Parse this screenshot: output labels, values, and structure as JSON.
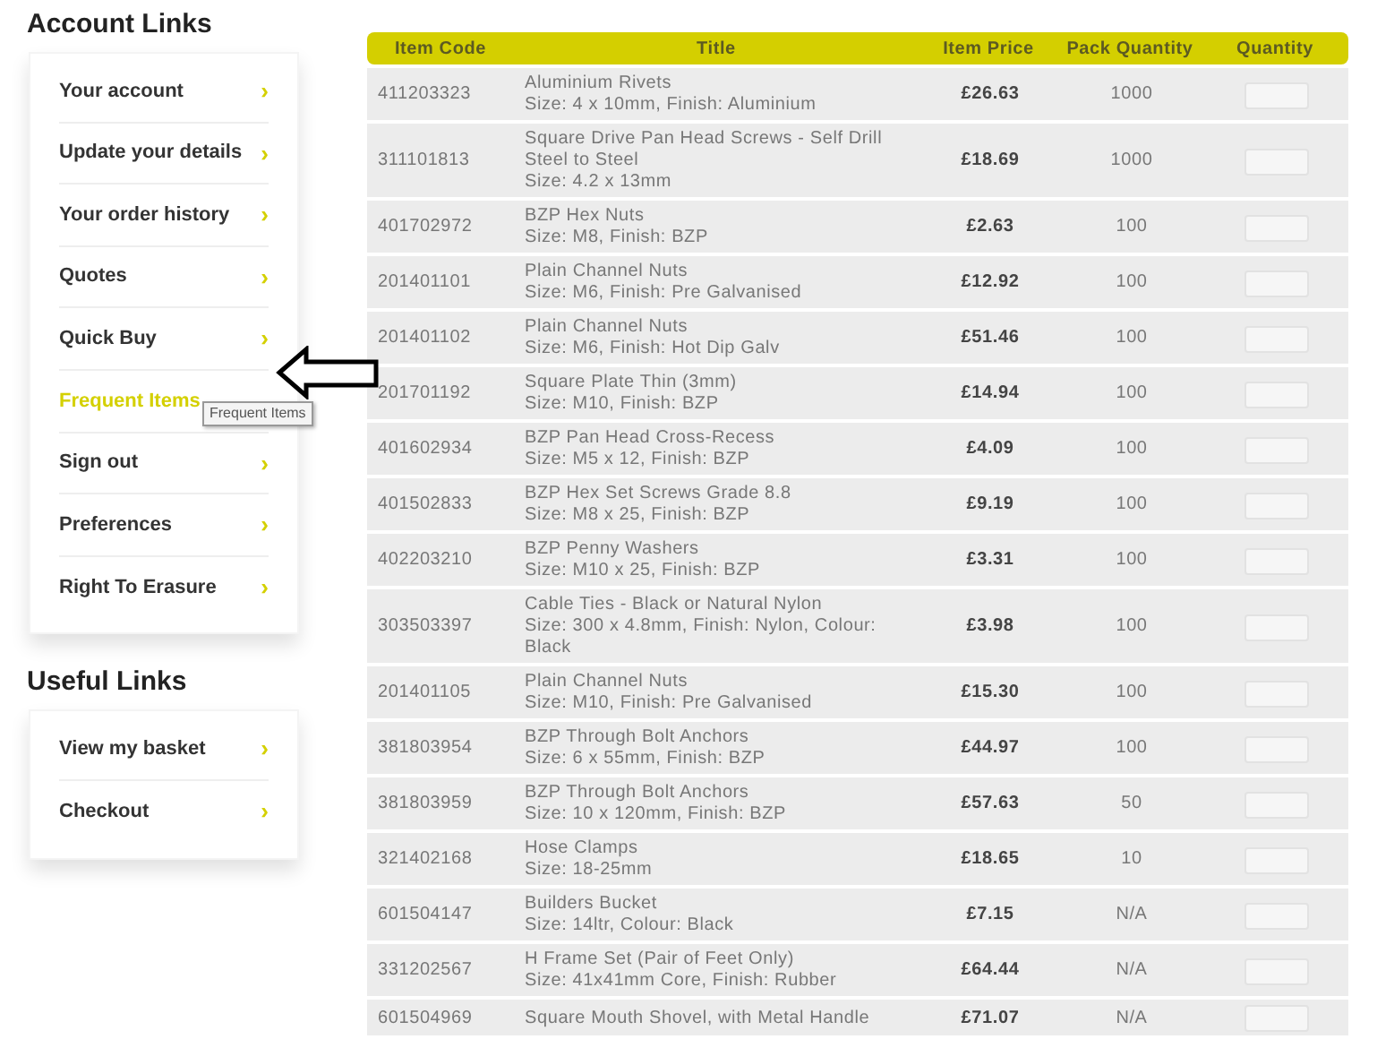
{
  "account_links": {
    "heading": "Account Links",
    "items": [
      {
        "label": "Your account",
        "chevron": "›",
        "selected": false
      },
      {
        "label": "Update your details",
        "chevron": "›",
        "selected": false
      },
      {
        "label": "Your order history",
        "chevron": "›",
        "selected": false
      },
      {
        "label": "Quotes",
        "chevron": "›",
        "selected": false
      },
      {
        "label": "Quick Buy",
        "chevron": "›",
        "selected": false
      },
      {
        "label": "Frequent Items",
        "selected": true
      },
      {
        "label": "Sign out",
        "chevron": "›",
        "selected": false
      },
      {
        "label": "Preferences",
        "chevron": "›",
        "selected": false
      },
      {
        "label": "Right To Erasure",
        "chevron": "›",
        "selected": false
      }
    ]
  },
  "tooltip": "Frequent Items",
  "useful_links": {
    "heading": "Useful Links",
    "items": [
      {
        "label": "View my basket",
        "chevron": "›",
        "selected": false
      },
      {
        "label": "Checkout",
        "chevron": "›",
        "selected": false
      }
    ]
  },
  "table": {
    "columns": [
      "Item Code",
      "Title",
      "Item Price",
      "Pack Quantity",
      "Quantity"
    ],
    "rows": [
      {
        "code": "411203323",
        "title": "Aluminium Rivets",
        "detail": "Size: 4 x 10mm, Finish: Aluminium",
        "price": "£26.63",
        "pack": "1000"
      },
      {
        "code": "311101813",
        "title": "Square Drive Pan Head Screws - Self Drill Steel to Steel",
        "detail": "Size: 4.2 x 13mm",
        "price": "£18.69",
        "pack": "1000"
      },
      {
        "code": "401702972",
        "title": "BZP Hex Nuts",
        "detail": "Size: M8, Finish: BZP",
        "price": "£2.63",
        "pack": "100"
      },
      {
        "code": "201401101",
        "title": "Plain Channel Nuts",
        "detail": "Size: M6, Finish: Pre Galvanised",
        "price": "£12.92",
        "pack": "100"
      },
      {
        "code": "201401102",
        "title": "Plain Channel Nuts",
        "detail": "Size: M6, Finish: Hot Dip Galv",
        "price": "£51.46",
        "pack": "100"
      },
      {
        "code": "201701192",
        "title": "Square Plate Thin (3mm)",
        "detail": "Size: M10, Finish: BZP",
        "price": "£14.94",
        "pack": "100"
      },
      {
        "code": "401602934",
        "title": "BZP Pan Head Cross-Recess",
        "detail": "Size: M5 x 12, Finish: BZP",
        "price": "£4.09",
        "pack": "100"
      },
      {
        "code": "401502833",
        "title": "BZP Hex Set Screws Grade 8.8",
        "detail": "Size: M8 x 25, Finish: BZP",
        "price": "£9.19",
        "pack": "100"
      },
      {
        "code": "402203210",
        "title": "BZP Penny Washers",
        "detail": "Size: M10 x 25, Finish: BZP",
        "price": "£3.31",
        "pack": "100"
      },
      {
        "code": "303503397",
        "title": "Cable Ties - Black or Natural Nylon",
        "detail": "Size: 300 x 4.8mm, Finish: Nylon, Colour: Black",
        "price": "£3.98",
        "pack": "100"
      },
      {
        "code": "201401105",
        "title": "Plain Channel Nuts",
        "detail": "Size: M10, Finish: Pre Galvanised",
        "price": "£15.30",
        "pack": "100"
      },
      {
        "code": "381803954",
        "title": "BZP Through Bolt Anchors",
        "detail": "Size: 6 x 55mm, Finish: BZP",
        "price": "£44.97",
        "pack": "100"
      },
      {
        "code": "381803959",
        "title": "BZP Through Bolt Anchors",
        "detail": "Size: 10 x 120mm, Finish: BZP",
        "price": "£57.63",
        "pack": "50"
      },
      {
        "code": "321402168",
        "title": "Hose Clamps",
        "detail": "Size: 18-25mm",
        "price": "£18.65",
        "pack": "10"
      },
      {
        "code": "601504147",
        "title": "Builders Bucket",
        "detail": "Size: 14ltr, Colour: Black",
        "price": "£7.15",
        "pack": "N/A"
      },
      {
        "code": "331202567",
        "title": "H Frame Set (Pair of Feet Only)",
        "detail": "Size: 41x41mm Core, Finish: Rubber",
        "price": "£64.44",
        "pack": "N/A"
      },
      {
        "code": "601504969",
        "title": "Square Mouth Shovel, with Metal Handle",
        "price": "£71.07",
        "pack": "N/A"
      }
    ]
  }
}
